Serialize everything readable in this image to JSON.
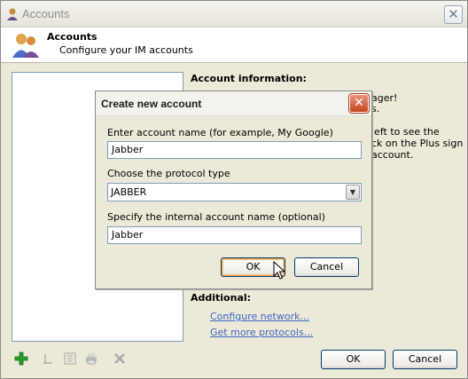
{
  "window": {
    "title": "Accounts",
    "header_title": "Accounts",
    "header_subtitle": "Configure your IM accounts"
  },
  "info": {
    "title": "Account information:",
    "bg_line1": "ager!",
    "bg_line2": "s.",
    "bg_line3": "left to see the",
    "bg_line4": "ck on the Plus sign",
    "bg_line5": "account."
  },
  "additional": {
    "title": "Additional:",
    "configure_network": "Configure network...",
    "get_more_protocols": "Get more protocols..."
  },
  "buttons": {
    "ok": "OK",
    "cancel": "Cancel"
  },
  "dialog": {
    "title": "Create new account",
    "account_name_label": "Enter account name (for example, My Google)",
    "account_name_value": "Jabber",
    "protocol_label": "Choose the protocol type",
    "protocol_value": "JABBER",
    "internal_name_label": "Specify the internal account name (optional)",
    "internal_name_value": "Jabber",
    "ok": "OK",
    "cancel": "Cancel"
  },
  "colors": {
    "link": "#3f66c9",
    "add_icon": "#2a9a2a",
    "dialog_close": "#c6461f"
  }
}
